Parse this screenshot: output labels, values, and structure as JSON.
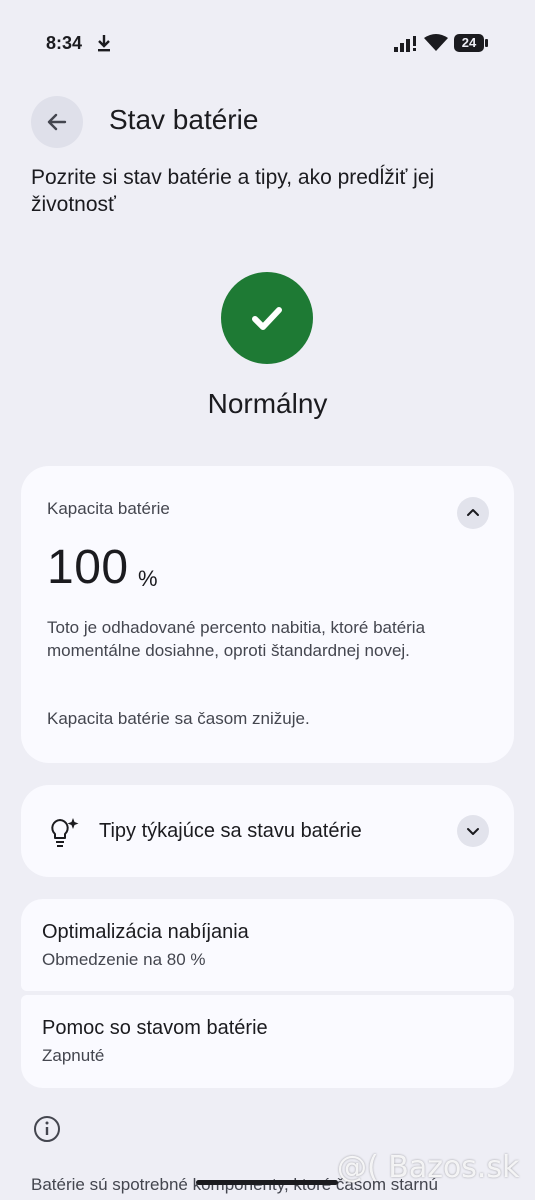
{
  "status_bar": {
    "time": "8:34",
    "battery_percent": "24"
  },
  "header": {
    "title": "Stav batérie",
    "subtitle": "Pozrite si stav batérie a tipy, ako predĺžiť jej životnosť"
  },
  "health": {
    "status": "Normálny",
    "color": "#1e7a34"
  },
  "capacity_card": {
    "label": "Kapacita batérie",
    "value": "100",
    "unit": "%",
    "description": "Toto je odhadované percento nabitia, ktoré batéria momentálne dosiahne, oproti štandardnej novej.",
    "note": "Kapacita batérie sa časom znižuje."
  },
  "tips_card": {
    "label": "Tipy týkajúce sa stavu batérie"
  },
  "settings": [
    {
      "title": "Optimalizácia nabíjania",
      "subtitle": "Obmedzenie na 80 %"
    },
    {
      "title": "Pomoc so stavom batérie",
      "subtitle": "Zapnuté"
    }
  ],
  "footer": {
    "text": "Batérie sú spotrebné komponenty, ktoré časom starnú"
  },
  "watermark": "@( Bazos.sk"
}
